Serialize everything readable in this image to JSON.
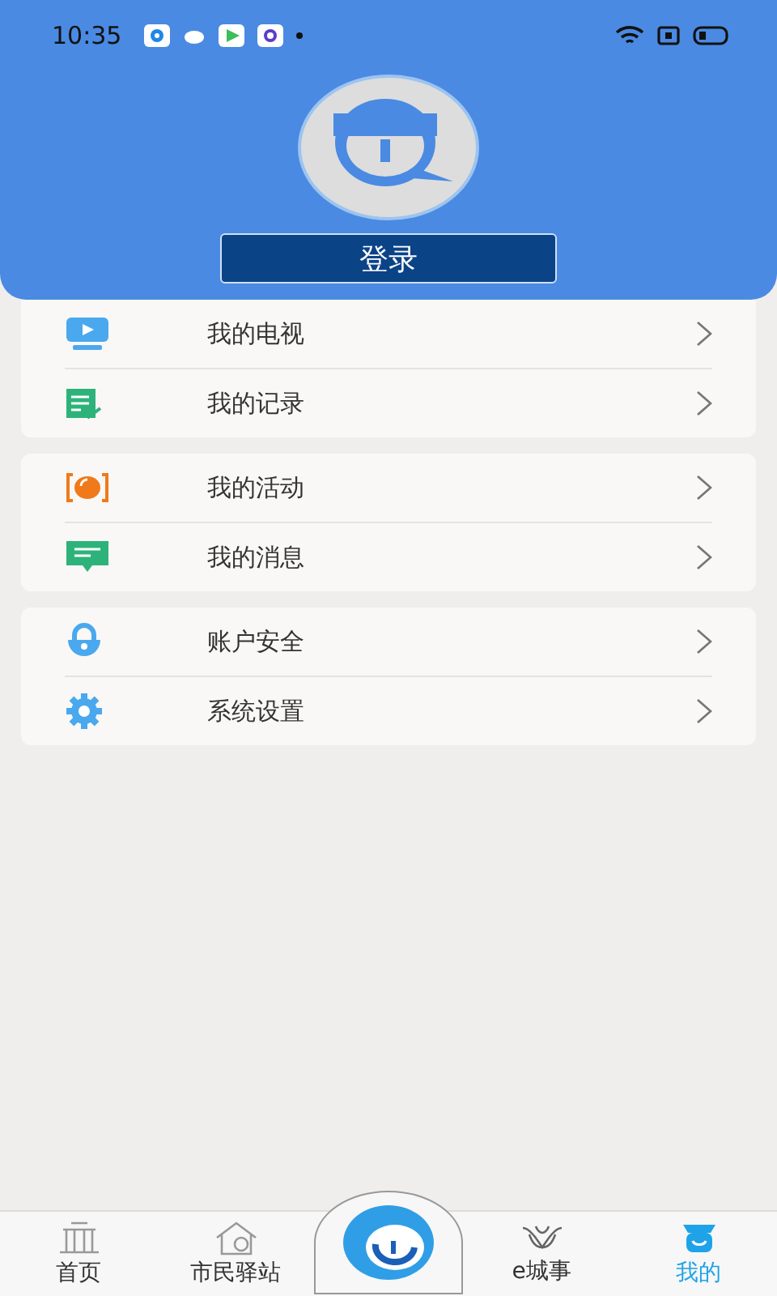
{
  "status_bar": {
    "time": "10:35"
  },
  "header": {
    "login_button": "登录"
  },
  "menu_groups": [
    {
      "items": [
        {
          "label": "我的电视"
        },
        {
          "label": "我的记录"
        }
      ]
    },
    {
      "items": [
        {
          "label": "我的活动"
        },
        {
          "label": "我的消息"
        }
      ]
    },
    {
      "items": [
        {
          "label": "账户安全"
        },
        {
          "label": "系统设置"
        }
      ]
    }
  ],
  "tab_bar": [
    {
      "kind": "tab",
      "label": "首页",
      "selected": false
    },
    {
      "kind": "tab",
      "label": "市民驿站",
      "selected": false
    },
    {
      "kind": "center",
      "selected": false
    },
    {
      "kind": "tab",
      "label": "e城事",
      "selected": false
    },
    {
      "kind": "tab",
      "label": "我的",
      "selected": true
    }
  ]
}
